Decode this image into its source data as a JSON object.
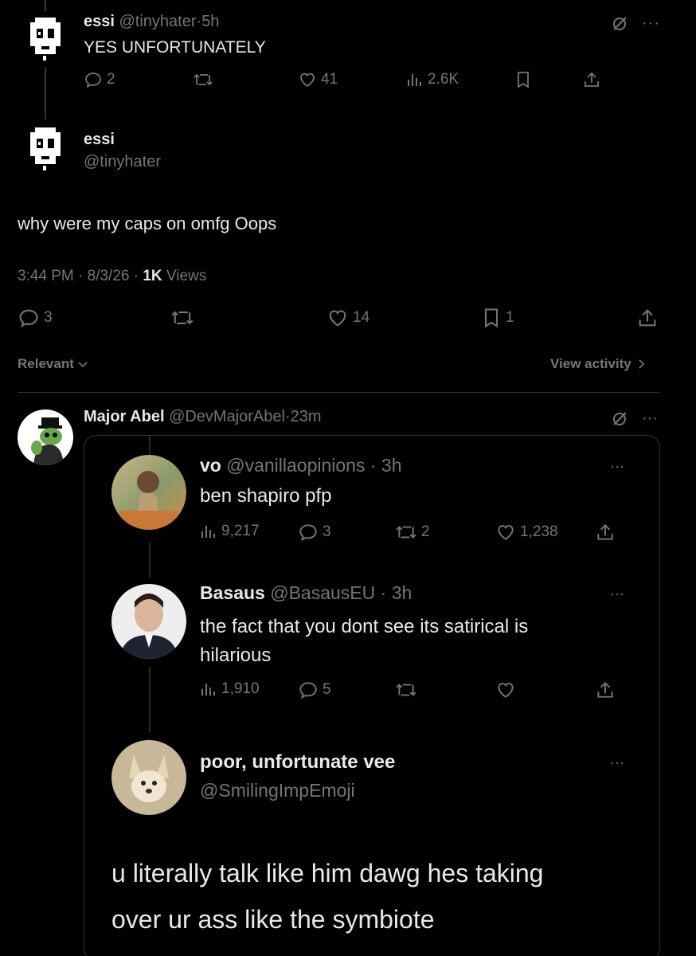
{
  "tweet1": {
    "display_name": "essi",
    "handle": "@tinyhater",
    "time": "5h",
    "text": "YES UNFORTUNATELY",
    "replies": "2",
    "likes": "41",
    "views": "2.6K"
  },
  "main": {
    "display_name": "essi",
    "handle": "@tinyhater",
    "text": "why were my caps on omfg Oops",
    "meta_time": "3:44 PM · 8/3/26 · ",
    "meta_views_count": "1K",
    "meta_views_label": " Views",
    "replies": "3",
    "likes": "14",
    "bookmarks": "1"
  },
  "sort": {
    "label": "Relevant",
    "view_activity": "View activity"
  },
  "reply": {
    "display_name": "Major Abel",
    "handle": "@DevMajorAbel",
    "time": "23m"
  },
  "embed": {
    "c1": {
      "display_name": "vo",
      "handle": "@vanillaopinions",
      "time": "3h",
      "text": "ben shapiro pfp",
      "views": "9,217",
      "replies": "3",
      "retweets": "2",
      "likes": "1,238"
    },
    "c2": {
      "display_name": "Basaus",
      "handle": "@BasausEU",
      "time": "3h",
      "text_line1": "the fact that you dont see its satirical is",
      "text_line2": "hilarious",
      "views": "1,910",
      "replies": "5"
    },
    "c3": {
      "display_name": "poor, unfortunate vee",
      "handle": "@SmilingImpEmoji",
      "text_line1": "u literally talk like him dawg hes taking",
      "text_line2": "over ur ass like the symbiote"
    }
  },
  "colors": {
    "background": "#000000",
    "text": "#e7e9ea",
    "muted": "#71767b",
    "divider": "#2f3336"
  }
}
